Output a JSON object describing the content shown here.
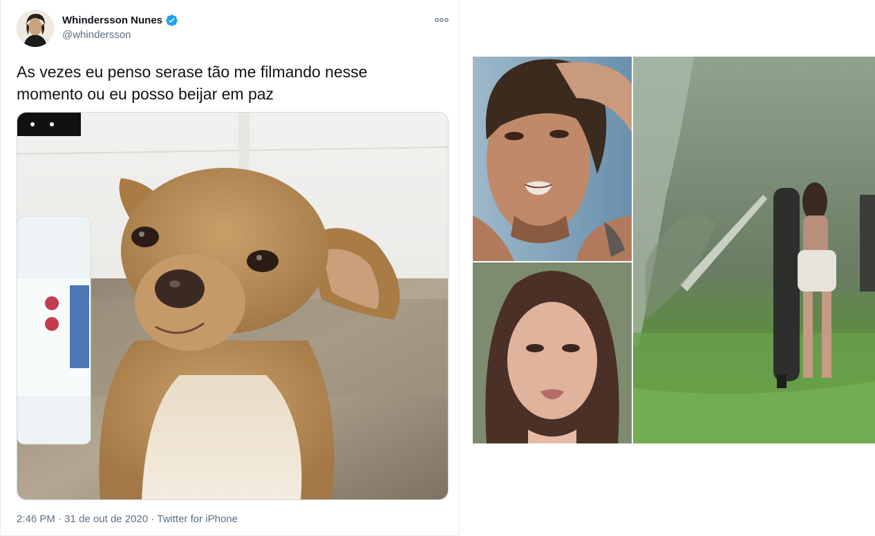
{
  "tweet": {
    "author": {
      "display_name": "Whindersson Nunes",
      "handle": "@whindersson",
      "verified": true
    },
    "text": "As vezes eu penso serase tão me filmando nesse\nmomento ou eu posso beijar em paz",
    "meta": {
      "time": "2:46 PM",
      "separator": "·",
      "date": "31 de out de 2020",
      "source": "Twitter for iPhone"
    }
  },
  "colors": {
    "text_primary": "#0f1419",
    "text_secondary": "#5b7083",
    "verified_blue": "#1da1f2",
    "border": "#e6ecf0"
  },
  "icons": {
    "verified": "verified-badge-icon",
    "more": "more-options-icon"
  }
}
